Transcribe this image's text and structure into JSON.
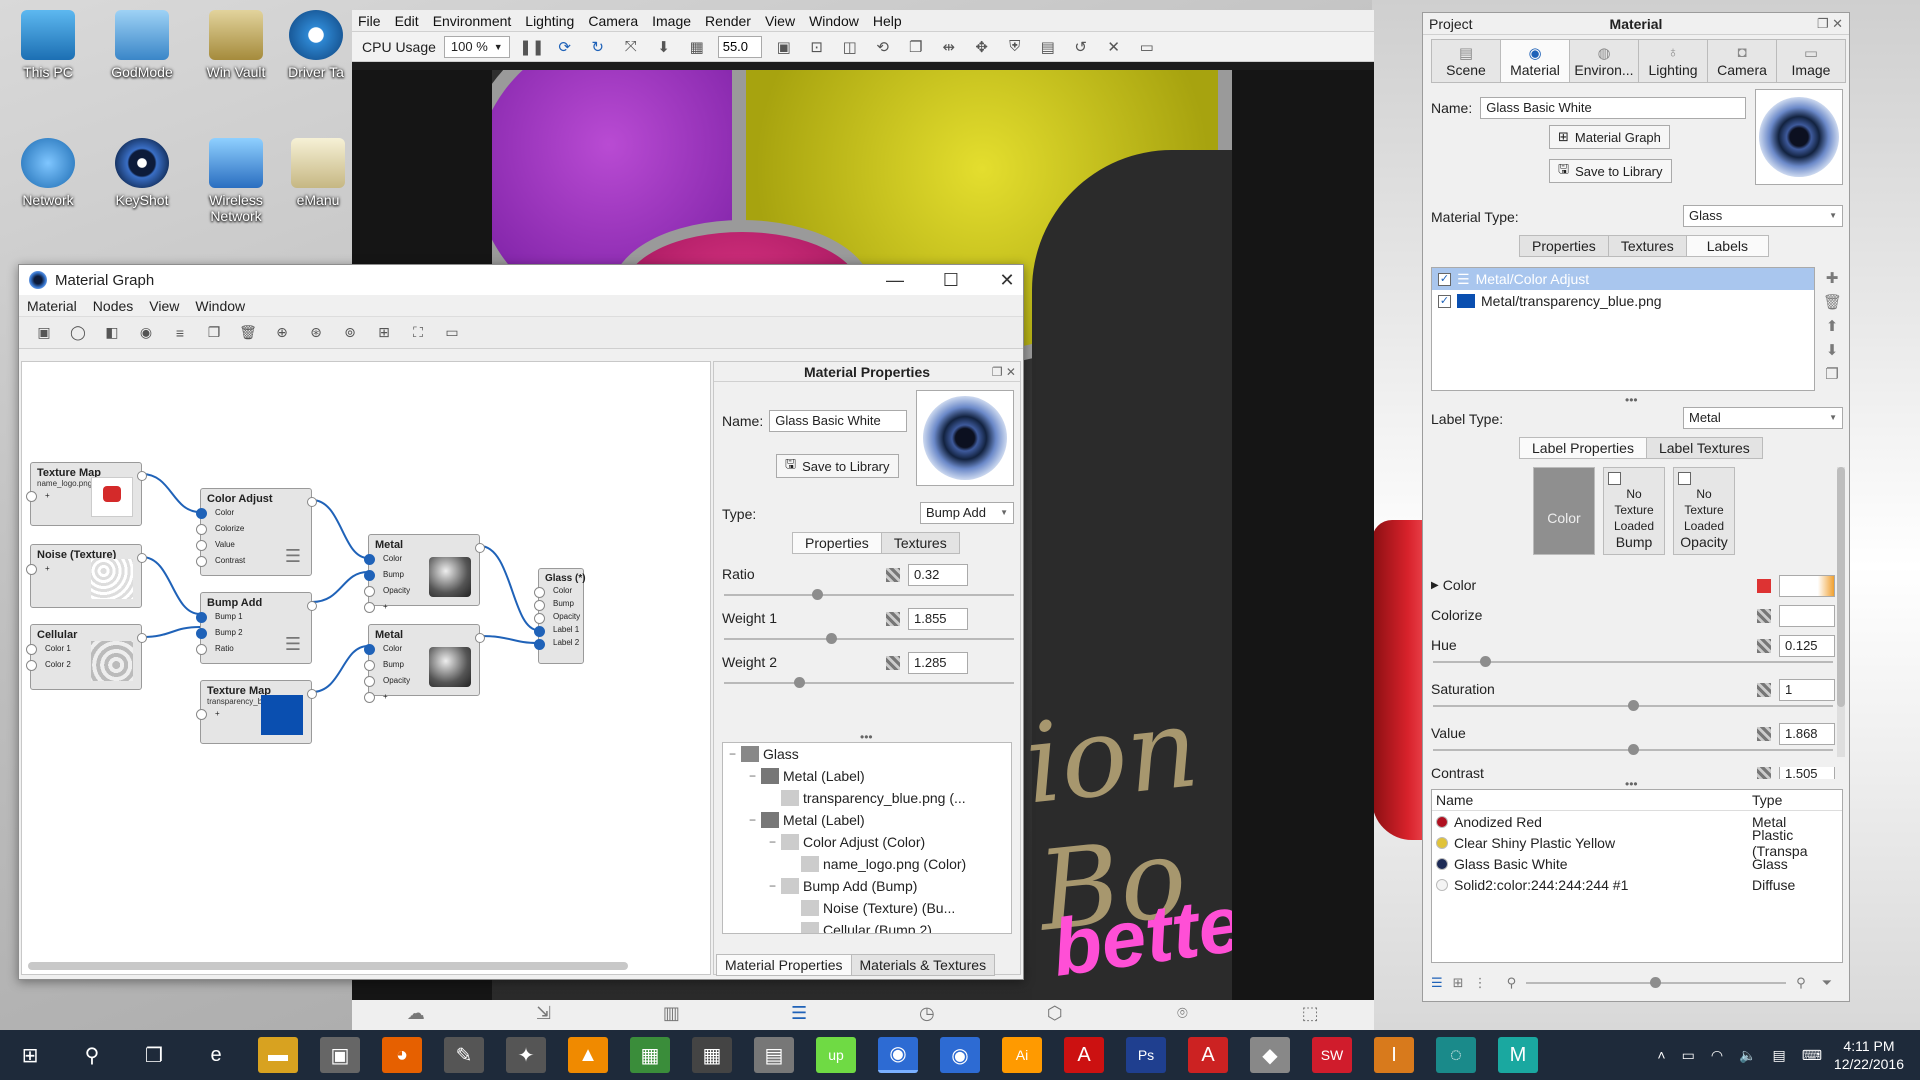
{
  "desktop": {
    "icons": [
      {
        "label": "This PC"
      },
      {
        "label": "GodMode"
      },
      {
        "label": "Win Vault"
      },
      {
        "label": "Driver Ta"
      },
      {
        "label": "Network"
      },
      {
        "label": "KeyShot"
      },
      {
        "label": "Wireless Network"
      },
      {
        "label": "eManu"
      }
    ]
  },
  "main_window": {
    "menu": [
      "File",
      "Edit",
      "Environment",
      "Lighting",
      "Camera",
      "Image",
      "Render",
      "View",
      "Window",
      "Help"
    ],
    "toolbar": {
      "cpu_label": "CPU Usage",
      "cpu_value": "100 %",
      "fov_value": "55.0"
    },
    "render_text": {
      "line1": "ion Bo",
      "line2": "bette"
    }
  },
  "material_graph": {
    "title": "Material Graph",
    "menu": [
      "Material",
      "Nodes",
      "View",
      "Window"
    ],
    "nodes": {
      "texture_map_1": {
        "title": "Texture Map",
        "sub": "name_logo.png",
        "ports": [
          "+"
        ]
      },
      "noise": {
        "title": "Noise (Texture)",
        "ports": [
          "+"
        ]
      },
      "cellular": {
        "title": "Cellular",
        "ports": [
          "Color 1",
          "Color 2"
        ]
      },
      "color_adjust": {
        "title": "Color Adjust",
        "ports": [
          "Color",
          "Colorize",
          "Value",
          "Contrast",
          "+"
        ]
      },
      "bump_add": {
        "title": "Bump Add",
        "ports": [
          "Bump 1",
          "Bump 2",
          "Ratio",
          "+"
        ]
      },
      "texture_map_2": {
        "title": "Texture Map",
        "sub": "transparency_blue.png",
        "ports": [
          "+"
        ]
      },
      "metal_1": {
        "title": "Metal",
        "ports": [
          "Color",
          "Bump",
          "Opacity",
          "+"
        ]
      },
      "metal_2": {
        "title": "Metal",
        "ports": [
          "Color",
          "Bump",
          "Opacity",
          "+"
        ]
      },
      "glass": {
        "title": "Glass (*)",
        "ports": [
          "Color",
          "Bump",
          "Opacity",
          "Label 1",
          "Label 2"
        ]
      }
    },
    "properties": {
      "title": "Material Properties",
      "name_label": "Name:",
      "name_value": "Glass Basic White",
      "save_label": "Save to Library",
      "type_label": "Type:",
      "type_value": "Bump Add",
      "tabs": [
        "Properties",
        "Textures"
      ],
      "params": [
        {
          "label": "Ratio",
          "value": "0.32",
          "level": 0.32
        },
        {
          "label": "Weight 1",
          "value": "1.855",
          "level": 0.37
        },
        {
          "label": "Weight 2",
          "value": "1.285",
          "level": 0.26
        }
      ],
      "tree": [
        {
          "label": "Glass",
          "depth": 0,
          "expander": "−"
        },
        {
          "label": "Metal (Label)",
          "depth": 1,
          "expander": "−"
        },
        {
          "label": "transparency_blue.png (...",
          "depth": 2,
          "expander": ""
        },
        {
          "label": "Metal (Label)",
          "depth": 1,
          "expander": "−"
        },
        {
          "label": "Color Adjust (Color)",
          "depth": 2,
          "expander": "−"
        },
        {
          "label": "name_logo.png (Color)",
          "depth": 3,
          "expander": ""
        },
        {
          "label": "Bump Add (Bump)",
          "depth": 2,
          "expander": "−"
        },
        {
          "label": "Noise (Texture) (Bu...",
          "depth": 3,
          "expander": ""
        },
        {
          "label": "Cellular (Bump 2)",
          "depth": 3,
          "expander": ""
        }
      ],
      "bottom_tabs": [
        "Material Properties",
        "Materials & Textures"
      ]
    }
  },
  "right_panel": {
    "project_label": "Project",
    "title": "Material",
    "tabs": [
      "Scene",
      "Material",
      "Environ...",
      "Lighting",
      "Camera",
      "Image"
    ],
    "name_label": "Name:",
    "name_value": "Glass Basic White",
    "material_graph_button": "Material Graph",
    "save_button": "Save to Library",
    "material_type_label": "Material Type:",
    "material_type_value": "Glass",
    "sub_tabs": [
      "Properties",
      "Textures",
      "Labels"
    ],
    "labels": [
      {
        "label": "Metal/Color Adjust",
        "selected": true
      },
      {
        "label": "Metal/transparency_blue.png",
        "selected": false
      }
    ],
    "label_type_label": "Label Type:",
    "label_type_value": "Metal",
    "label_tabs": [
      "Label Properties",
      "Label Textures"
    ],
    "slots": [
      {
        "caption": "Color",
        "text": ""
      },
      {
        "caption": "Bump",
        "text": "No Texture Loaded"
      },
      {
        "caption": "Opacity",
        "text": "No Texture Loaded"
      }
    ],
    "params": [
      {
        "label": "Color",
        "value": ""
      },
      {
        "label": "Colorize",
        "value": ""
      },
      {
        "label": "Hue",
        "value": "0.125",
        "level": 0.13
      },
      {
        "label": "Saturation",
        "value": "1",
        "level": 0.5
      },
      {
        "label": "Value",
        "value": "1.868",
        "level": 0.5
      },
      {
        "label": "Contrast",
        "value": "1.505"
      }
    ],
    "library": {
      "columns": [
        "Name",
        "Type"
      ],
      "rows": [
        {
          "name": "Anodized Red",
          "type": "Metal",
          "color": "#b01020"
        },
        {
          "name": "Clear Shiny Plastic Yellow",
          "type": "Plastic (Transpa",
          "color": "#e0c33a"
        },
        {
          "name": "Glass Basic White",
          "type": "Glass",
          "color": "#1d2b56"
        },
        {
          "name": "Solid2:color:244:244:244 #1",
          "type": "Diffuse",
          "color": "#f4f4f4"
        }
      ]
    }
  },
  "taskbar": {
    "clock_time": "4:11 PM",
    "clock_date": "12/22/2016",
    "apps": [
      "start-icon",
      "search-icon",
      "task-view-icon",
      "edge-icon",
      "file-explorer-icon",
      "app-icon",
      "firefox-icon",
      "app-icon",
      "app-icon",
      "vlc-icon",
      "app-icon",
      "calculator-icon",
      "app-icon",
      "upwork-icon",
      "keyshot-icon",
      "keyshot-icon",
      "illustrator-icon",
      "acrobat-icon",
      "photoshop-icon",
      "autodesk-icon",
      "app-icon",
      "solidworks-icon",
      "app-icon",
      "app-icon",
      "app-icon"
    ]
  },
  "colors": {
    "accent": "#1f62b8",
    "selected_row": "#a9c6ee",
    "taskbar": "#1e2a3a"
  }
}
